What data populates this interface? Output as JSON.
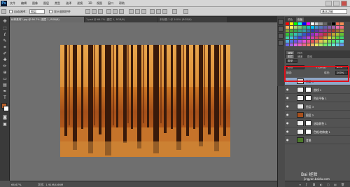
{
  "app": {
    "logo": "Ps"
  },
  "menubar": {
    "items": [
      "文件",
      "编辑",
      "图像",
      "图层",
      "类型",
      "选择",
      "滤镜",
      "3D",
      "视图",
      "窗口",
      "帮助"
    ]
  },
  "options": {
    "auto_select_label": "自动选择：",
    "auto_select_value": "图层",
    "show_transform_label": "显示变换控件",
    "workspace": "基本功能"
  },
  "tabs": [
    {
      "label": "树林素材2.jpg @ 66.7% (图层 1, RGB/8)",
      "active": true
    },
    {
      "label": "1.psd @ 66.7% (图层 1, RGB/8)",
      "active": false
    },
    {
      "label": "未标题-1 @ 100% (RGB/8)",
      "active": false
    }
  ],
  "toolbox": {
    "tools": [
      "move-tool",
      "marquee-tool",
      "lasso-tool",
      "quick-select-tool",
      "crop-tool",
      "eyedropper-tool",
      "healing-tool",
      "brush-tool",
      "clone-tool",
      "history-brush-tool",
      "eraser-tool",
      "gradient-tool",
      "blur-tool",
      "dodge-tool",
      "pen-tool",
      "type-tool",
      "path-select-tool",
      "shape-tool",
      "hand-tool",
      "zoom-tool"
    ],
    "foreground_color": "#b8612c",
    "background_color": "#ffffff"
  },
  "status": {
    "zoom": "66.67%",
    "doc_size": "文档：1.91M/4.66M"
  },
  "right_panels": {
    "top_tabs": [
      "颜色",
      "色板"
    ],
    "adjust_tabs": [
      "调整",
      "样式"
    ],
    "layer_tabs": [
      "图层",
      "通道",
      "路径"
    ],
    "swatch_colors": [
      "#ff0000",
      "#ffff00",
      "#00ff00",
      "#00ffff",
      "#0000ff",
      "#ff00ff",
      "#ffffff",
      "#cccccc",
      "#999999",
      "#666666",
      "#333333",
      "#000000",
      "#f26c4f",
      "#f68e55",
      "#fbaf5c",
      "#fff467",
      "#acd372",
      "#7cc576",
      "#3bb878",
      "#1abbb4",
      "#00bff3",
      "#438ccb",
      "#5574b9",
      "#605ca8",
      "#855fa8",
      "#a763a8",
      "#f06ea9",
      "#f26d7d"
    ],
    "blend_mode": "滤色",
    "opacity_label": "不透明度:",
    "opacity": "80%",
    "lock_label": "锁定:",
    "fill_label": "填充:",
    "fill": "100%",
    "kind_label": "类型"
  },
  "layers": [
    {
      "name": "图层 1",
      "type": "pixel",
      "thumb": "#d9d9d9",
      "selected": true
    },
    {
      "name": "曲线 1",
      "type": "adjustment",
      "selected": false
    },
    {
      "name": "色彩平衡 1",
      "type": "adjustment",
      "selected": false
    },
    {
      "name": "图层 3",
      "type": "pixel",
      "thumb": "#e8e8e8",
      "selected": false
    },
    {
      "name": "图层 2",
      "type": "pixel",
      "thumb": "#a8501c",
      "selected": false
    },
    {
      "name": "选取颜色 1",
      "type": "adjustment",
      "selected": false
    },
    {
      "name": "色相/饱和度 1",
      "type": "adjustment",
      "selected": false
    },
    {
      "name": "背景",
      "type": "pixel",
      "thumb": "#4c7a2a",
      "selected": false
    }
  ],
  "watermark": {
    "text": "Bai 经验",
    "sub": "jingyan.baidu.com"
  }
}
